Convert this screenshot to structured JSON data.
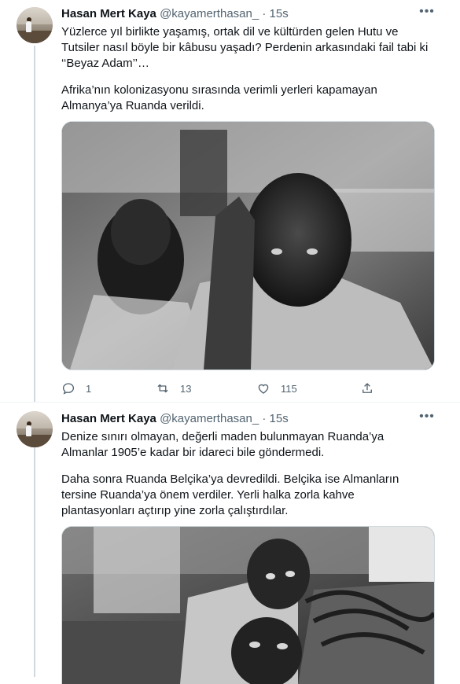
{
  "tweets": [
    {
      "author_name": "Hasan Mert Kaya",
      "handle": "@kayamerthasan_",
      "separator": "·",
      "time": "15s",
      "more_label": "•••",
      "paragraphs": [
        "Yüzlerce yıl birlikte yaşamış, ortak dil ve kültürden gelen Hutu ve Tutsiler nasıl böyle bir kâbusu yaşadı? Perdenin arkasındaki fail tabi ki ‘‘Beyaz Adam’’…",
        "Afrika’nın kolonizasyonu sırasında verimli yerleri kapamayan Almanya’ya Ruanda verildi."
      ],
      "media_icon": "photo",
      "actions": {
        "reply_count": "1",
        "retweet_count": "13",
        "like_count": "115"
      }
    },
    {
      "author_name": "Hasan Mert Kaya",
      "handle": "@kayamerthasan_",
      "separator": "·",
      "time": "15s",
      "more_label": "•••",
      "paragraphs": [
        "Denize sınırı olmayan, değerli maden bulunmayan Ruanda’ya Almanlar 1905’e kadar bir idareci bile göndermedi.",
        "Daha sonra Ruanda Belçika’ya devredildi. Belçika ise Almanların tersine Ruanda’ya önem verdiler. Yerli halka zorla kahve plantasyonları açtırıp yine zorla çalıştırdılar."
      ],
      "media_icon": "photo"
    }
  ],
  "icons": {
    "reply": "reply-icon",
    "retweet": "retweet-icon",
    "like": "like-icon",
    "share": "share-icon"
  }
}
